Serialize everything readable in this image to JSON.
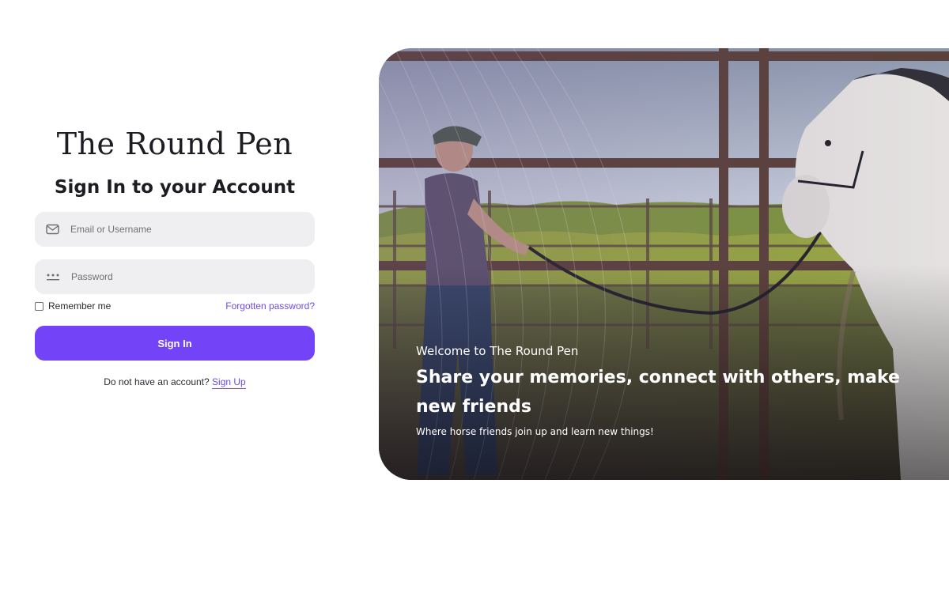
{
  "brand": {
    "name": "The Round Pen"
  },
  "form": {
    "heading": "Sign In to your Account",
    "email": {
      "placeholder": "Email or Username",
      "value": "",
      "icon": "envelope-icon"
    },
    "password": {
      "placeholder": "Password",
      "value": "",
      "icon": "password-dots-icon"
    },
    "remember_label": "Remember me",
    "remember_checked": false,
    "forgot_label": "Forgotten password?",
    "submit_label": "Sign In",
    "signup_prompt": "Do not have an account?",
    "signup_link": "Sign Up"
  },
  "hero": {
    "eyebrow": "Welcome to The Round Pen",
    "title": "Share your memories, connect with others, make new friends",
    "subtitle": "Where horse friends join up and learn new things!"
  },
  "colors": {
    "accent": "#7243f7",
    "link": "#6c4be8",
    "field_bg": "#efeef0"
  }
}
